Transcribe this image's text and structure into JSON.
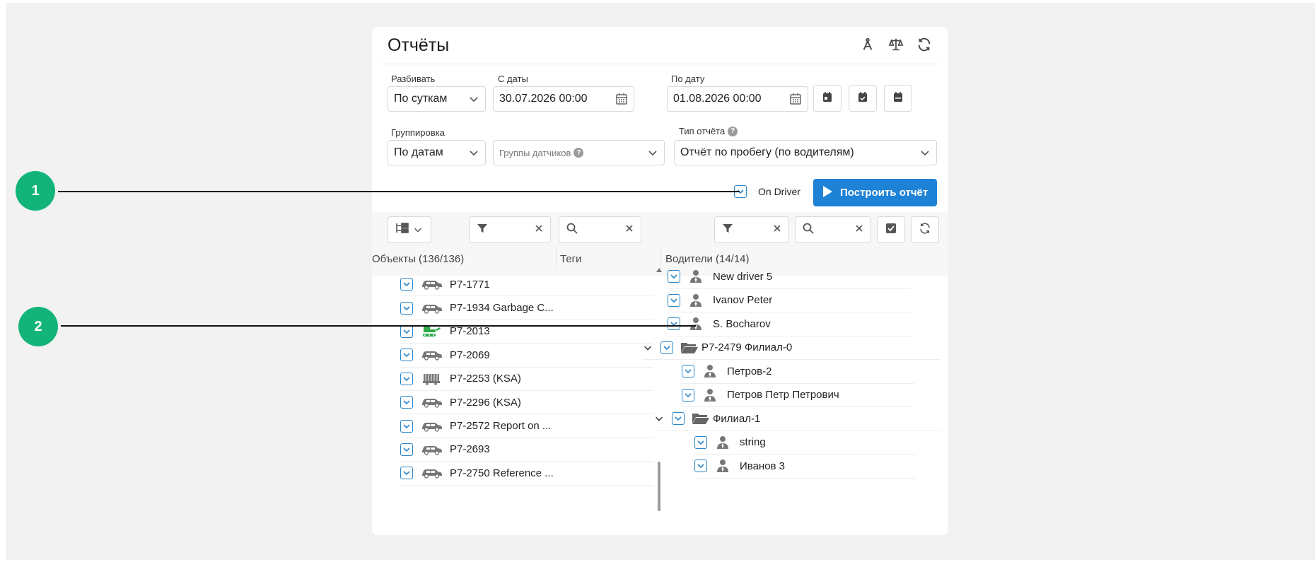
{
  "header": {
    "title": "Отчёты",
    "icons": [
      "compass-icon",
      "scales-icon",
      "refresh-icon"
    ]
  },
  "form": {
    "split_label": "Разбивать",
    "split_value": "По суткам",
    "from_label": "С даты",
    "from_value": "30.07.2026 00:00",
    "to_label": "По дату",
    "to_value": "01.08.2026 00:00",
    "grouping_label": "Группировка",
    "grouping_value": "По датам",
    "sensor_groups_placeholder": "Группы датчиков",
    "report_type_label": "Тип отчёта",
    "report_type_value": "Отчёт по пробегу (по водителям)",
    "on_driver_label": "On Driver",
    "on_driver_checked": true,
    "build_button": "Построить отчёт"
  },
  "left_panel": {
    "objects_header": "Объекты (136/136)",
    "tags_header": "Теги",
    "items": [
      {
        "name": "P7-1771",
        "icon": "car-icon"
      },
      {
        "name": "P7-1934 Garbage C...",
        "icon": "car-icon"
      },
      {
        "name": "P7-2013",
        "icon": "tractor-icon"
      },
      {
        "name": "P7-2069",
        "icon": "car-icon"
      },
      {
        "name": "P7-2253 (KSA)",
        "icon": "truck-icon"
      },
      {
        "name": "P7-2296 (KSA)",
        "icon": "car-icon"
      },
      {
        "name": "P7-2572 Report on ...",
        "icon": "car-icon"
      },
      {
        "name": "P7-2693",
        "icon": "car-icon"
      },
      {
        "name": "P7-2750 Reference ...",
        "icon": "car-icon"
      }
    ]
  },
  "right_panel": {
    "drivers_header": "Водители (14/14)",
    "items": [
      {
        "name": "New driver 5",
        "type": "driver",
        "level": 0
      },
      {
        "name": "Ivanov Peter",
        "type": "driver",
        "level": 0
      },
      {
        "name": "S. Bocharov",
        "type": "driver",
        "level": 0
      },
      {
        "name": "P7-2479 Филиал-0",
        "type": "group",
        "level": 0
      },
      {
        "name": "Петров-2",
        "type": "driver",
        "level": 1
      },
      {
        "name": "Петров Петр Петрович",
        "type": "driver",
        "level": 1
      },
      {
        "name": "Филиал-1",
        "type": "group",
        "level": 1
      },
      {
        "name": "string",
        "type": "driver",
        "level": 2
      },
      {
        "name": "Иванов 3",
        "type": "driver",
        "level": 2
      }
    ]
  },
  "callouts": [
    "1",
    "2"
  ],
  "colors": {
    "accent": "#1e82d6",
    "callout": "#12b47a",
    "checkbox": "#2a86c8"
  }
}
